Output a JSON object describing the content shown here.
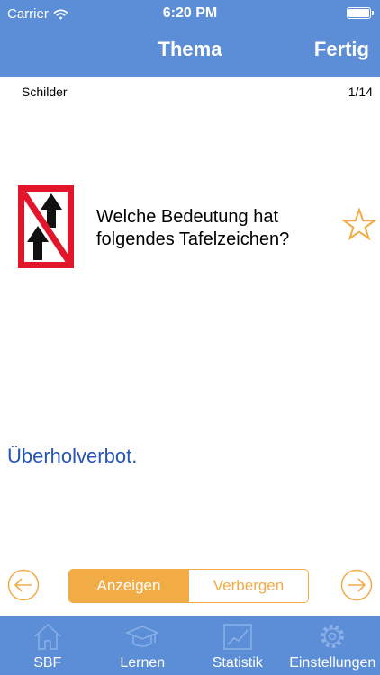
{
  "status": {
    "carrier": "Carrier",
    "time": "6:20 PM"
  },
  "nav": {
    "title": "Thema",
    "done_label": "Fertig"
  },
  "card": {
    "topic": "Schilder",
    "counter": "1/14",
    "question": "Welche Bedeutung hat folgendes Tafelzeichen?",
    "answer": "Überholverbot."
  },
  "segment": {
    "show_label": "Anzeigen",
    "hide_label": "Verbergen"
  },
  "tabs": [
    {
      "label": "SBF",
      "icon": "home-icon"
    },
    {
      "label": "Lernen",
      "icon": "graduation-cap-icon"
    },
    {
      "label": "Statistik",
      "icon": "chart-icon"
    },
    {
      "label": "Einstellungen",
      "icon": "gear-icon"
    }
  ],
  "colors": {
    "header": "#5c8ed8",
    "accent": "#f2ac45",
    "answer": "#2754b5",
    "sign_red": "#e3152b"
  }
}
